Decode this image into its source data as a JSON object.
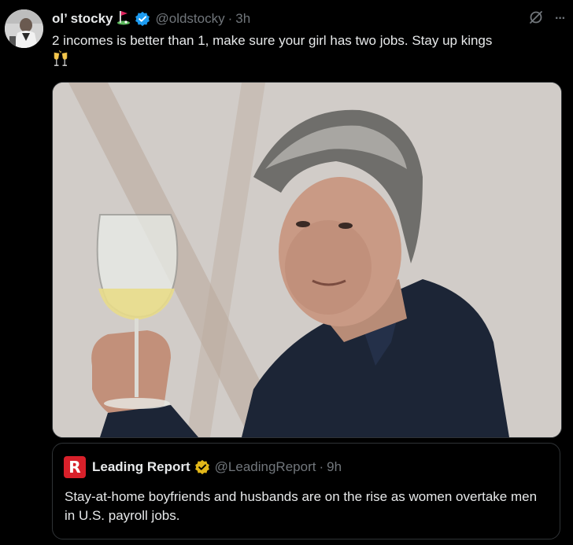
{
  "tweet": {
    "display_name": "ol’ stocky",
    "handle": "@oldstocky",
    "separator": "·",
    "time": "3h",
    "text": "2 incomes is better than 1, make sure your girl has two jobs. Stay up kings",
    "more_label": "···",
    "emojis": [
      "golf-flag",
      "clinking-glasses"
    ]
  },
  "quote": {
    "display_name": "Leading Report",
    "handle": "@LeadingReport",
    "separator": "·",
    "time": "9h",
    "text": "Stay-at-home boyfriends and husbands are on the rise as women overtake men in U.S. payroll jobs.",
    "logo_letter": "R"
  },
  "colors": {
    "background": "#000000",
    "text": "#e7e9ea",
    "muted": "#71767b",
    "verified_blue": "#1d9bf0",
    "verified_gold": "#e2b719",
    "logo_red": "#d8202a",
    "border": "#2f3336"
  }
}
